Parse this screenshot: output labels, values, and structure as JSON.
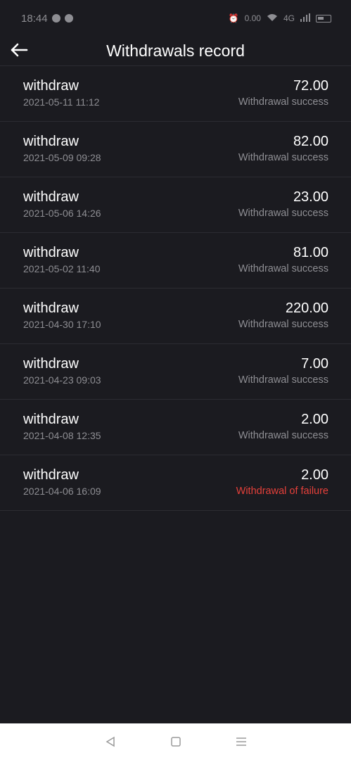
{
  "status_bar": {
    "time": "18:44",
    "network_speed": "0.00",
    "signal": "4G"
  },
  "header": {
    "title": "Withdrawals record"
  },
  "records": [
    {
      "label": "withdraw",
      "date": "2021-05-11 11:12",
      "amount": "72.00",
      "status": "Withdrawal success"
    },
    {
      "label": "withdraw",
      "date": "2021-05-09 09:28",
      "amount": "82.00",
      "status": "Withdrawal success"
    },
    {
      "label": "withdraw",
      "date": "2021-05-06 14:26",
      "amount": "23.00",
      "status": "Withdrawal success"
    },
    {
      "label": "withdraw",
      "date": "2021-05-02 11:40",
      "amount": "81.00",
      "status": "Withdrawal success"
    },
    {
      "label": "withdraw",
      "date": "2021-04-30 17:10",
      "amount": "220.00",
      "status": "Withdrawal success"
    },
    {
      "label": "withdraw",
      "date": "2021-04-23 09:03",
      "amount": "7.00",
      "status": "Withdrawal success"
    },
    {
      "label": "withdraw",
      "date": "2021-04-08 12:35",
      "amount": "2.00",
      "status": "Withdrawal success"
    },
    {
      "label": "withdraw",
      "date": "2021-04-06 16:09",
      "amount": "2.00",
      "status": "Withdrawal of failure"
    }
  ],
  "colors": {
    "background": "#1b1b20",
    "success_text": "#8e8e93",
    "failure_text": "#e5403a"
  }
}
